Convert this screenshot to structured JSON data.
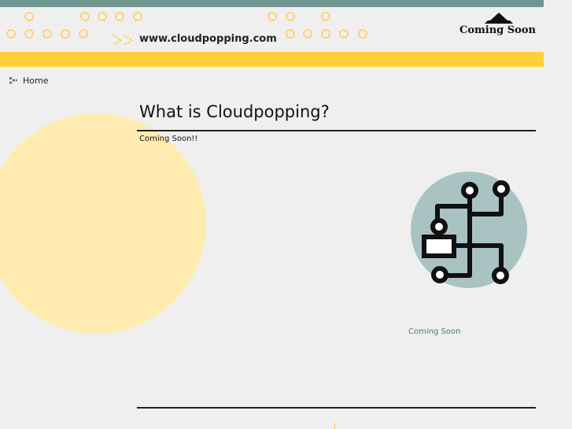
{
  "header": {
    "site_url": "www.cloudpopping.com",
    "logo_text": "Coming Soon"
  },
  "nav": {
    "home_label": "Home"
  },
  "main": {
    "title": "What is Cloudpopping?",
    "subtitle": "Coming Soon!!",
    "caption": "Coming Soon"
  },
  "icons": {
    "header_arrows": "double-chevron-right-icon",
    "nav_bullet": "dots-bullet-icon",
    "logo": "pyramid-logo-icon",
    "illustration": "circuit-board-icon"
  },
  "colors": {
    "top_bar": "#6f9590",
    "accent_yellow": "#ffcf38",
    "ring_color": "#ffd27a",
    "soft_circle": "#ffebb0",
    "illustration_bg": "#a9c3c2",
    "caption_teal": "#4a7a78"
  }
}
